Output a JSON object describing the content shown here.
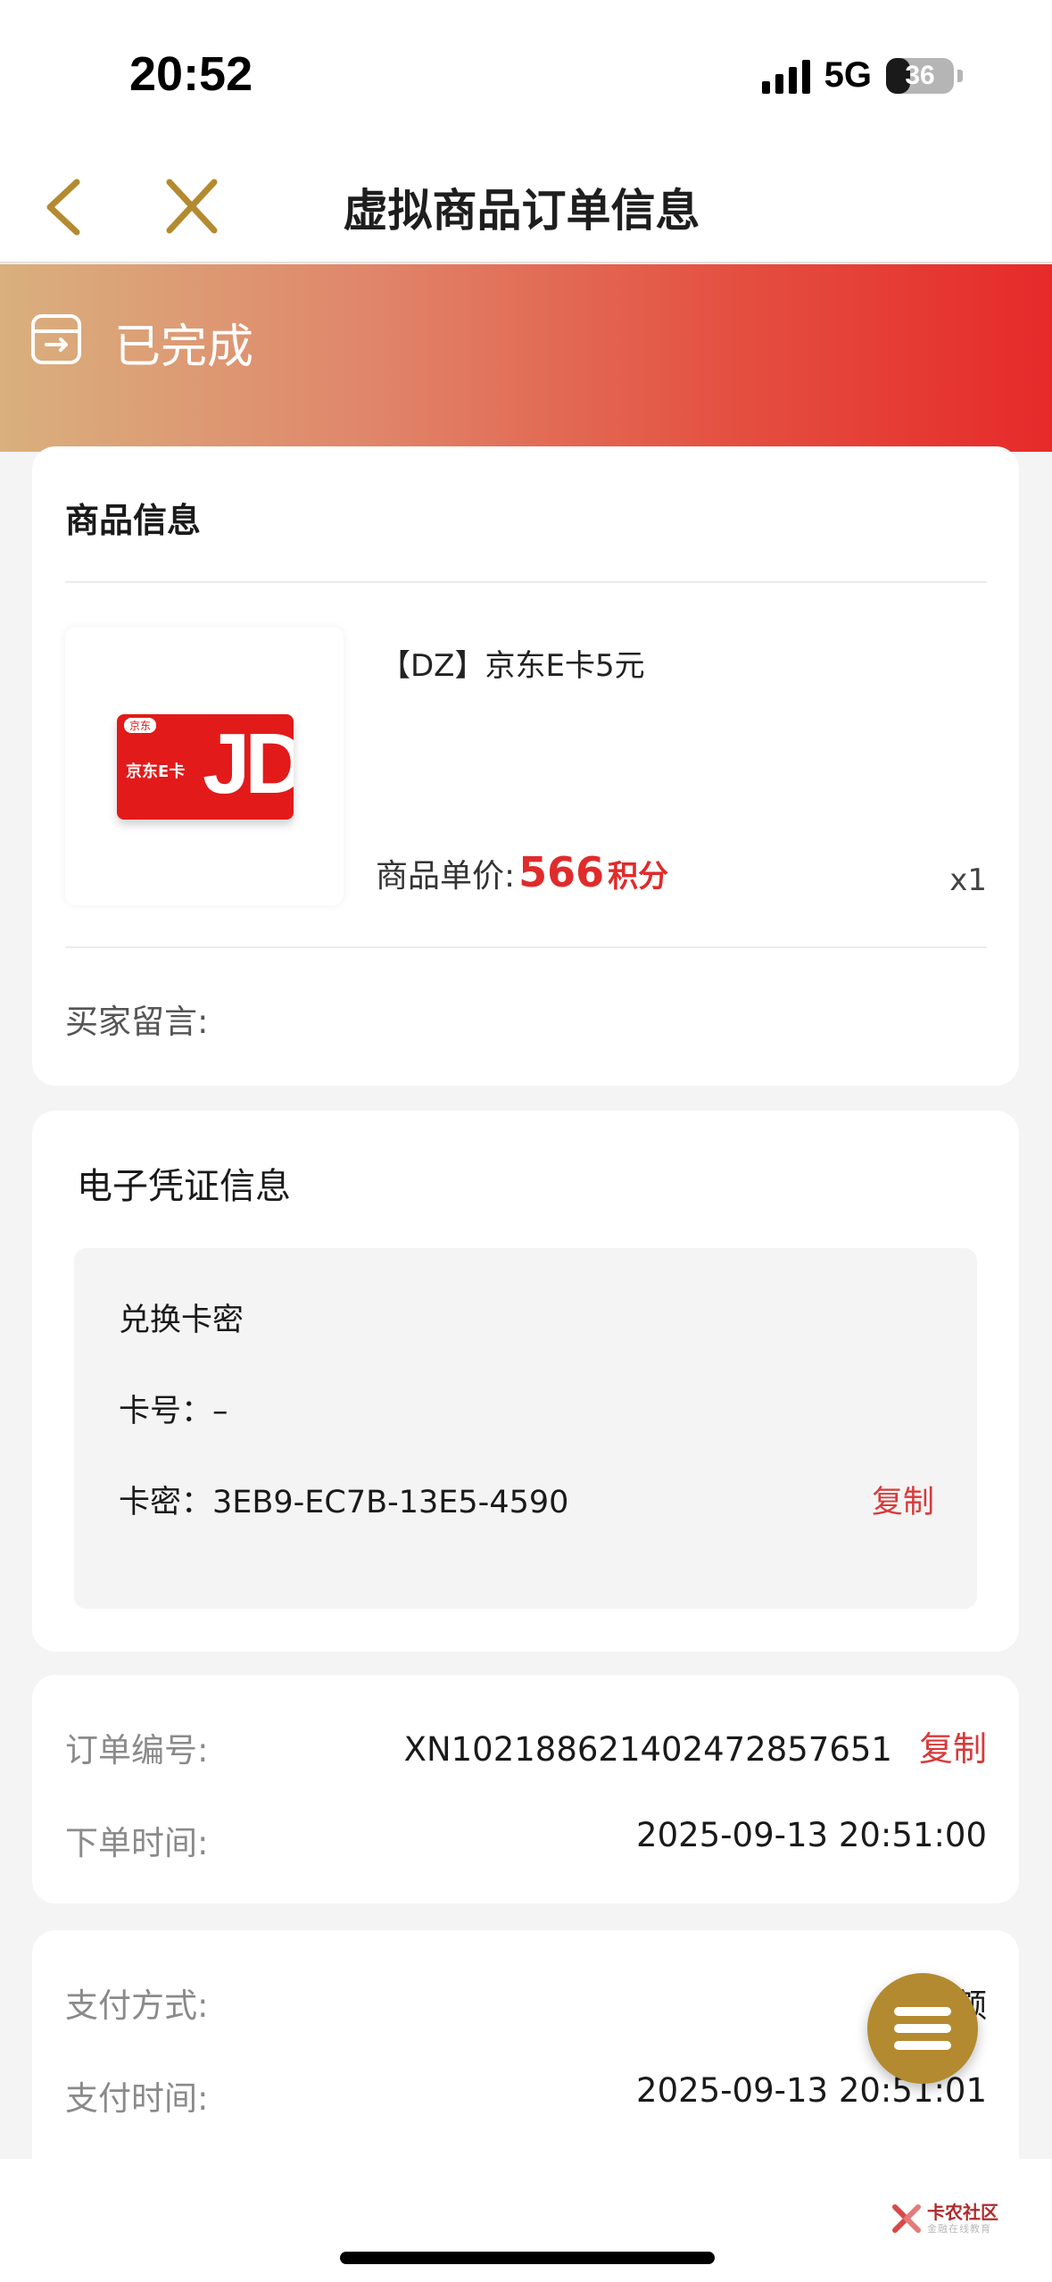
{
  "status_bar": {
    "time": "20:52",
    "network": "5G",
    "battery": "36",
    "battery_level": 0.36
  },
  "nav": {
    "title": "虚拟商品订单信息",
    "back_icon": "chevron-left-icon",
    "close_icon": "close-icon"
  },
  "order_status": {
    "label": "已完成",
    "icon": "order-box-icon"
  },
  "product": {
    "section_title": "商品信息",
    "name": "【DZ】京东E卡5元",
    "price_label": "商品单价:",
    "price_value": "566",
    "price_unit": "积分",
    "quantity": "x1",
    "buyer_note_label": "买家留言:",
    "image_card_label": "京东E卡",
    "image_card_brand": "京东",
    "image_logo_text": "JD"
  },
  "voucher": {
    "section_title": "电子凭证信息",
    "box_title": "兑换卡密",
    "card_number_label": "卡号：",
    "card_number": "–",
    "card_secret_label": "卡密：",
    "card_secret": "3EB9-EC7B-13E5-4590",
    "copy_label": "复制"
  },
  "order_info": {
    "order_no_label": "订单编号:",
    "order_no": "XN10218862140247285765​1",
    "copy_label": "复制",
    "order_time_label": "下单时间:",
    "order_time": "2025-09-13 20:51:00"
  },
  "payment": {
    "method_label": "支付方式:",
    "method_value": "额",
    "time_label": "支付时间:",
    "time_value": "2025-09-13 20:51:01"
  },
  "floating_menu": {
    "icon": "menu-icon"
  },
  "watermark": {
    "title": "卡农社区",
    "subtitle": "金融在线教育"
  },
  "colors": {
    "accent_red": "#e02b2b",
    "nav_gold": "#b38a2f",
    "banner_start": "#d9b07e",
    "banner_end": "#e62a2a"
  }
}
